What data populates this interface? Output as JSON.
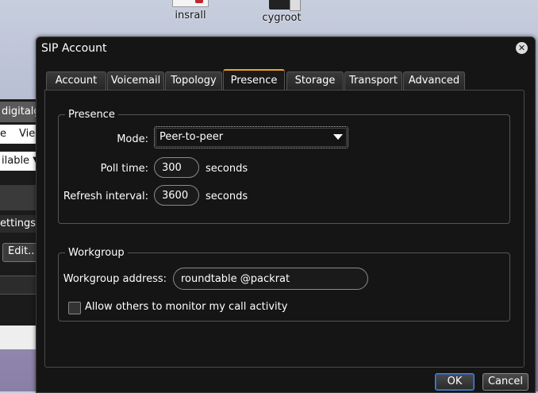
{
  "desktop": {
    "icons": [
      {
        "label": "insrall",
        "icon": "pdf-document-icon"
      },
      {
        "label": "cygroot",
        "icon": "cygwin-icon"
      }
    ]
  },
  "background_app": {
    "title_fragment": "digitalgl",
    "menu_fragments": [
      "e",
      "Vie"
    ],
    "status_fragment": "ilable",
    "settings_fragment": "ettings",
    "edit_label": "Edit..."
  },
  "dialog": {
    "title": "SIP Account",
    "tabs": [
      {
        "label": "Account"
      },
      {
        "label": "Voicemail"
      },
      {
        "label": "Topology"
      },
      {
        "label": "Presence",
        "active": true
      },
      {
        "label": "Storage"
      },
      {
        "label": "Transport"
      },
      {
        "label": "Advanced"
      }
    ],
    "presence": {
      "legend": "Presence",
      "mode_label": "Mode:",
      "mode_value": "Peer-to-peer",
      "poll_label": "Poll time:",
      "poll_value": "300",
      "poll_unit": "seconds",
      "refresh_label": "Refresh interval:",
      "refresh_value": "3600",
      "refresh_unit": "seconds"
    },
    "workgroup": {
      "legend": "Workgroup",
      "address_label": "Workgroup address:",
      "address_value": "roundtable @packrat",
      "monitor_label": "Allow others to monitor my call activity",
      "monitor_checked": false
    },
    "buttons": {
      "ok": "OK",
      "cancel": "Cancel"
    }
  },
  "colors": {
    "accent_tab": "#f0a020",
    "default_button": "#4a86d8"
  }
}
